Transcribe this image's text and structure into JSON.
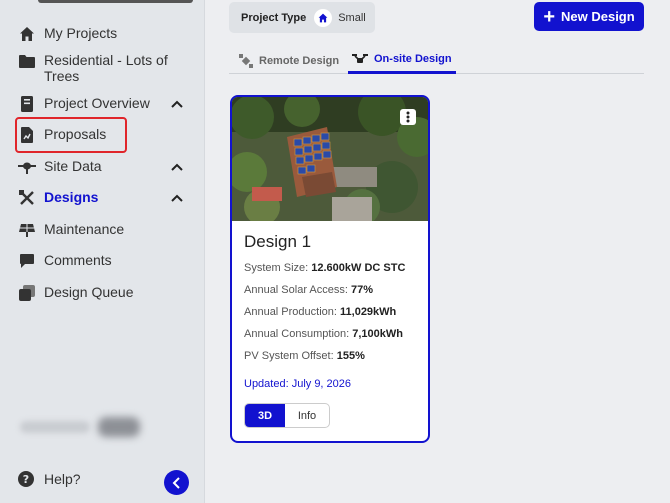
{
  "sidebar": {
    "items": [
      {
        "label": "My Projects"
      },
      {
        "label": "Residential - Lots of Trees"
      },
      {
        "label": "Project Overview"
      },
      {
        "label": "Proposals"
      },
      {
        "label": "Site Data"
      },
      {
        "label": "Designs"
      },
      {
        "label": "Maintenance"
      },
      {
        "label": "Comments"
      },
      {
        "label": "Design Queue"
      }
    ],
    "help_label": "Help?"
  },
  "filter": {
    "key": "Project Type",
    "value": "Small"
  },
  "new_design_label": "New Design",
  "tabs": [
    {
      "label": "Remote Design"
    },
    {
      "label": "On-site Design"
    }
  ],
  "design": {
    "title": "Design 1",
    "system_size_label": "System Size:",
    "system_size": "12.600kW DC STC",
    "solar_access_label": "Annual Solar Access:",
    "solar_access": "77%",
    "production_label": "Annual Production:",
    "production": "11,029kWh",
    "consumption_label": "Annual Consumption:",
    "consumption": "7,100kWh",
    "offset_label": "PV System Offset:",
    "offset": "155%",
    "updated": "Updated: July 9, 2026",
    "view_3d": "3D",
    "view_info": "Info"
  },
  "colors": {
    "accent": "#1212cf",
    "highlight": "#e0252b"
  }
}
